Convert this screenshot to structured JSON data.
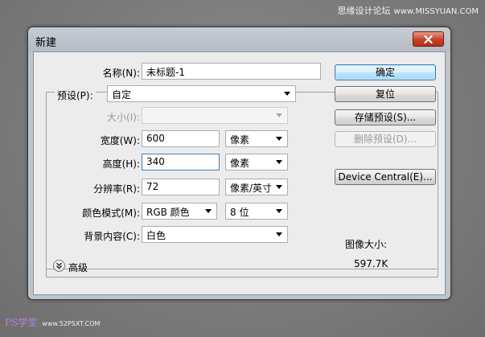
{
  "watermark": {
    "top_text": "思缘设计论坛",
    "top_site": "www.MISSYUAN.COM",
    "bottom_brand": "PS学堂",
    "bottom_site": "www.52PSXT.COM"
  },
  "dialog": {
    "title": "新建",
    "name_label": "名称(N):",
    "name_value": "未标题-1",
    "preset_label": "预设(P):",
    "preset_value": "自定",
    "size_label": "大小(I):",
    "size_value": "",
    "width_label": "宽度(W):",
    "width_value": "600",
    "width_unit": "像素",
    "height_label": "高度(H):",
    "height_value": "340",
    "height_unit": "像素",
    "resolution_label": "分辨率(R):",
    "resolution_value": "72",
    "resolution_unit": "像素/英寸",
    "color_mode_label": "颜色模式(M):",
    "color_mode_value": "RGB 颜色",
    "bit_depth_value": "8 位",
    "background_label": "背景内容(C):",
    "background_value": "白色",
    "advanced_label": "高级"
  },
  "buttons": {
    "ok": "确定",
    "reset": "复位",
    "save_preset": "存储预设(S)...",
    "delete_preset": "删除预设(D)...",
    "device_central": "Device Central(E)..."
  },
  "image_size": {
    "label": "图像大小:",
    "value": "597.7K"
  }
}
